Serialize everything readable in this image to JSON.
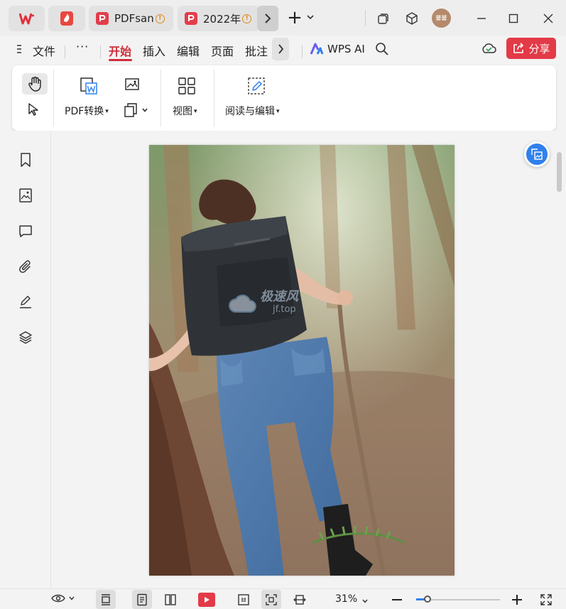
{
  "titlebar": {
    "tabs": [
      {
        "label": "PDFsan",
        "warning": "!"
      },
      {
        "label": "2022年",
        "warning": "!"
      }
    ],
    "new_tab": "+",
    "avatar_text": "馨馨"
  },
  "menubar": {
    "file_label": "文件",
    "more_label": "···",
    "items": [
      "开始",
      "插入",
      "编辑",
      "页面",
      "批注"
    ],
    "active_item": "开始",
    "ai_label": "WPS AI",
    "share_label": "分享"
  },
  "ribbon": {
    "pdf_convert": "PDF转换",
    "view": "视图",
    "read_edit": "阅读与编辑"
  },
  "document": {
    "watermark_line1": "极速风",
    "watermark_line2": "jf.top"
  },
  "statusbar": {
    "zoom": "31%",
    "zoom_fraction": 0.14
  },
  "colors": {
    "accent": "#d12c3a",
    "share": "#e33a47",
    "blue": "#2f80ed"
  }
}
